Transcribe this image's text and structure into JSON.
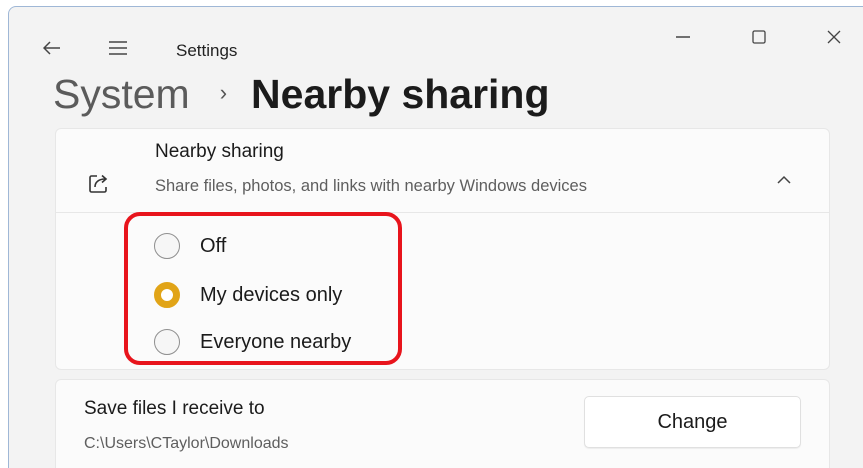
{
  "window": {
    "app_title": "Settings"
  },
  "breadcrumb": {
    "root": "System",
    "separator": "›",
    "page": "Nearby sharing"
  },
  "nearby_sharing": {
    "title": "Nearby sharing",
    "subtitle": "Share files, photos, and links with nearby Windows devices",
    "icon": "share-icon",
    "expanded": true,
    "options": [
      {
        "label": "Off",
        "selected": false
      },
      {
        "label": "My devices only",
        "selected": true
      },
      {
        "label": "Everyone nearby",
        "selected": false
      }
    ]
  },
  "save_location": {
    "title": "Save files I receive to",
    "path": "C:\\Users\\CTaylor\\Downloads",
    "button_label": "Change"
  },
  "colors": {
    "accent": "#e1a417",
    "highlight_border": "#e8141c"
  }
}
